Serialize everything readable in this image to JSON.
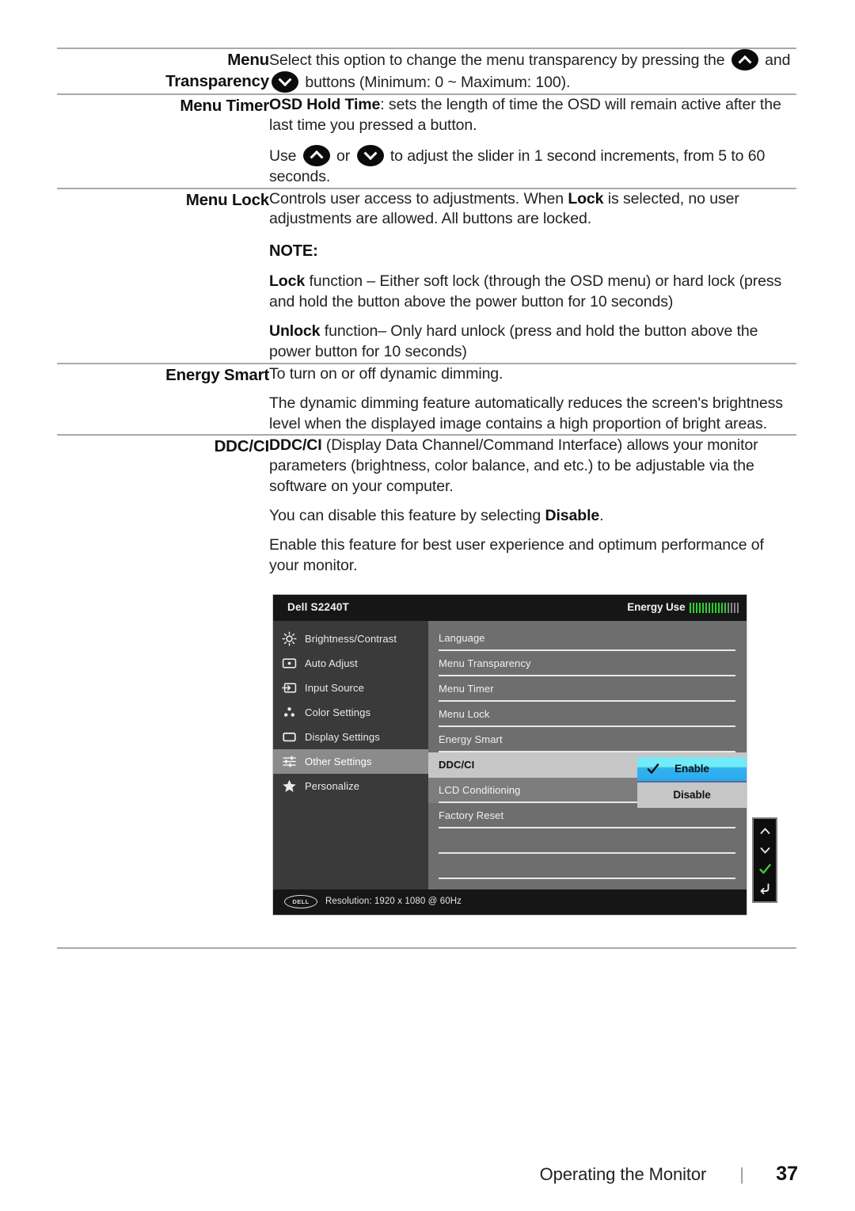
{
  "document": {
    "footer": {
      "section_title": "Operating the Monitor",
      "separator": "|",
      "page_number": "37"
    }
  },
  "table": {
    "rows": [
      {
        "label": "Menu\nTransparency",
        "label_lines": [
          "Menu",
          "Transparency"
        ],
        "paragraphs": [
          "Select this option to change the menu transparency by pressing the  [UP]  and  [DOWN]  buttons (Minimum: 0 ~ Maximum: 100)."
        ]
      },
      {
        "label": "Menu Timer",
        "paragraphs": [
          "OSD Hold Time: sets the length of time the OSD will remain active after the last time you pressed a button.",
          "Use  [UP]  or  [DOWN]  to adjust the slider in 1 second increments, from 5 to 60 seconds."
        ]
      },
      {
        "label": "Menu Lock",
        "paragraphs": [
          "Controls user access to adjustments. When Lock is selected, no user adjustments are allowed. All buttons are locked.",
          "NOTE:",
          "Lock function – Either soft lock (through the OSD menu) or hard lock (press and hold the button above the power button for 10 seconds)",
          "Unlock function– Only hard unlock (press and hold the button above the power button for 10 seconds)"
        ]
      },
      {
        "label": "Energy Smart",
        "paragraphs": [
          "To turn on or off dynamic dimming.",
          "The dynamic dimming feature automatically reduces the screen's brightness level when the displayed image contains a high proportion of bright areas."
        ]
      },
      {
        "label": "DDC/CI",
        "paragraphs": [
          "DDC/CI (Display Data Channel/Command Interface) allows your monitor parameters (brightness, color balance, and etc.) to be adjustable via the software on your computer.",
          "You can disable this feature by selecting Disable.",
          "Enable this feature for best user experience and optimum performance of your monitor."
        ]
      }
    ],
    "text": {
      "r1_p1_a": "Select this option to change the menu transparency by pressing the",
      "r1_p1_b": "and",
      "r1_p1_c": "buttons (Minimum: 0 ~ Maximum: 100).",
      "r2_p1_bold": "OSD Hold Time",
      "r2_p1_rest": ": sets the length of time the OSD will remain active after the last time you pressed a button.",
      "r2_p2_a": "Use",
      "r2_p2_b": "or",
      "r2_p2_c": "to adjust the slider in 1 second increments, from 5 to 60 seconds.",
      "r3_p1_a": "Controls user access to adjustments. When",
      "r3_p1_bold": "Lock",
      "r3_p1_b": "is selected, no user adjustments are allowed. All buttons are locked.",
      "r3_note": "NOTE:",
      "r3_p2_bold": "Lock",
      "r3_p2_rest": "function – Either soft lock (through the OSD menu) or hard lock (press and hold the button above the power button for 10 seconds)",
      "r3_p3_bold": "Unlock",
      "r3_p3_rest": "function– Only hard unlock (press and hold the button above the power button for 10 seconds)",
      "r4_p1": "To turn on or off dynamic dimming.",
      "r4_p2": "The dynamic dimming feature automatically reduces the screen's brightness level when the displayed image contains a high proportion of bright areas.",
      "r5_p1_bold": "DDC/CI",
      "r5_p1_rest": "(Display Data Channel/Command Interface) allows your monitor parameters (brightness, color balance, and etc.) to be adjustable via the software on your computer.",
      "r5_p2_a": "You can disable this feature by selecting",
      "r5_p2_bold": "Disable",
      "r5_p2_b": ".",
      "r5_p3": "Enable this feature for best user experience and optimum performance of your monitor."
    },
    "labels": {
      "r1a": "Menu",
      "r1b": "Transparency",
      "r2": "Menu Timer",
      "r3": "Menu Lock",
      "r4": "Energy Smart",
      "r5": "DDC/CI"
    }
  },
  "osd": {
    "model": "Dell S2240T",
    "energy": {
      "label": "Energy Use",
      "bars_on": 12,
      "bars_off": 4,
      "color_on": "#2fd12f",
      "color_off": "#8a8a8a"
    },
    "sidebar": [
      {
        "label": "Brightness/Contrast",
        "icon": "brightness-icon",
        "active": false
      },
      {
        "label": "Auto Adjust",
        "icon": "auto-adjust-icon",
        "active": false
      },
      {
        "label": "Input Source",
        "icon": "input-source-icon",
        "active": false
      },
      {
        "label": "Color Settings",
        "icon": "color-settings-icon",
        "active": false
      },
      {
        "label": "Display Settings",
        "icon": "display-settings-icon",
        "active": false
      },
      {
        "label": "Other Settings",
        "icon": "other-settings-icon",
        "active": true
      },
      {
        "label": "Personalize",
        "icon": "personalize-star-icon",
        "active": false
      }
    ],
    "options": [
      {
        "label": "Language",
        "state": "normal"
      },
      {
        "label": "Menu Transparency",
        "state": "normal"
      },
      {
        "label": "Menu Timer",
        "state": "normal"
      },
      {
        "label": "Menu Lock",
        "state": "normal"
      },
      {
        "label": "Energy Smart",
        "state": "normal"
      },
      {
        "label": "DDC/CI",
        "state": "selected"
      },
      {
        "label": "LCD Conditioning",
        "state": "sub-selected"
      },
      {
        "label": "Factory Reset",
        "state": "normal"
      }
    ],
    "submenu": {
      "items": [
        {
          "label": "Enable",
          "checked": true
        },
        {
          "label": "Disable",
          "checked": false
        }
      ],
      "highlight_top": "#72eaf7",
      "highlight_bottom": "#33b5f0"
    },
    "footer": {
      "logo_text": "DELL",
      "resolution": "Resolution: 1920 x 1080 @ 60Hz"
    },
    "hw_buttons": [
      {
        "name": "up-chevron-icon"
      },
      {
        "name": "down-chevron-icon"
      },
      {
        "name": "confirm-check-icon"
      },
      {
        "name": "back-arrow-icon"
      }
    ]
  }
}
